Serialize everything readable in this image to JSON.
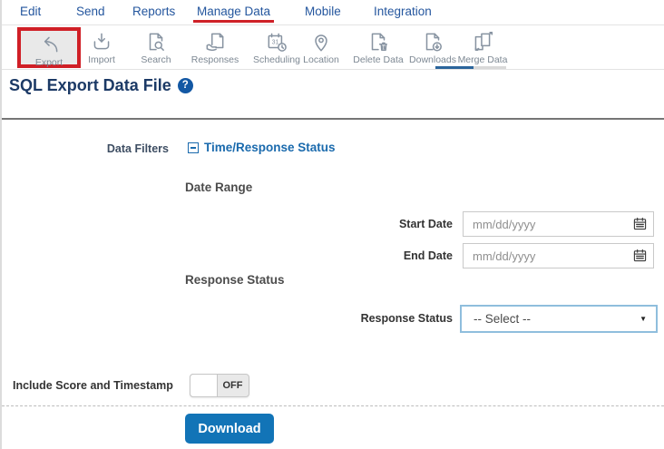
{
  "colors": {
    "nav_blue": "#24569e",
    "accent_red": "#d01f26",
    "link_blue": "#1a6aad",
    "button_blue": "#1274b7",
    "title_navy": "#1c3a66"
  },
  "nav": {
    "items": [
      {
        "label": "Edit"
      },
      {
        "label": "Send"
      },
      {
        "label": "Reports"
      },
      {
        "label": "Manage Data",
        "active": true
      },
      {
        "label": "Mobile"
      },
      {
        "label": "Integration"
      }
    ]
  },
  "toolbar": {
    "items": [
      {
        "label": "Export",
        "icon": "export-icon",
        "highlighted": true
      },
      {
        "label": "Import",
        "icon": "import-icon"
      },
      {
        "label": "Search",
        "icon": "search-icon"
      },
      {
        "label": "Responses",
        "icon": "responses-icon"
      },
      {
        "label": "Scheduling",
        "icon": "scheduling-icon"
      },
      {
        "label": "Location",
        "icon": "location-icon"
      },
      {
        "label": "Delete Data",
        "icon": "delete-data-icon"
      },
      {
        "label": "Downloads",
        "icon": "downloads-icon"
      },
      {
        "label": "Merge Data",
        "icon": "merge-data-icon"
      }
    ]
  },
  "page": {
    "title": "SQL Export Data File",
    "help": "?"
  },
  "filters": {
    "label": "Data Filters",
    "group": "Time/Response Status"
  },
  "date_range": {
    "heading": "Date Range",
    "start_label": "Start Date",
    "end_label": "End Date",
    "start_placeholder": "mm/dd/yyyy",
    "end_placeholder": "mm/dd/yyyy"
  },
  "response_status": {
    "heading": "Response Status",
    "label": "Response Status",
    "selected": "-- Select --"
  },
  "score": {
    "label": "Include Score and Timestamp",
    "state": "OFF"
  },
  "actions": {
    "download": "Download"
  },
  "icons": {
    "select_caret": "▼"
  }
}
